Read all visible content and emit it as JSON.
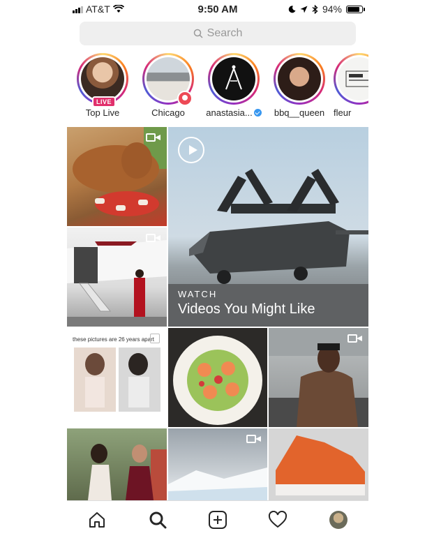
{
  "status_bar": {
    "carrier": "AT&T",
    "time": "9:50 AM",
    "battery_percent": "94%",
    "battery_level": 0.94
  },
  "search": {
    "placeholder": "Search"
  },
  "stories": [
    {
      "name": "Top Live",
      "badge": "LIVE"
    },
    {
      "name": "Chicago"
    },
    {
      "name": "anastasia...",
      "verified": true
    },
    {
      "name": "bbq__queen"
    },
    {
      "name": "fleur"
    }
  ],
  "grid": {
    "feature": {
      "kicker": "WATCH",
      "title": "Videos You Might Like"
    },
    "caption_tile": "these pictures are 26 years apart"
  },
  "tabbar": {
    "items": [
      "home-icon",
      "search-icon",
      "add-post-icon",
      "activity-heart-icon",
      "profile-avatar"
    ]
  },
  "colors": {
    "live": "#e1306c",
    "location": "#ed4956",
    "verified": "#3897f0"
  }
}
